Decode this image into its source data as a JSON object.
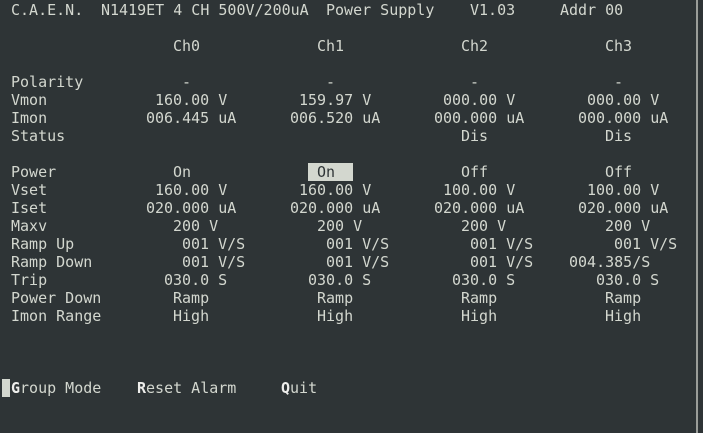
{
  "title": {
    "brand": "C.A.E.N.",
    "model": "N1419ET 4 CH 500V/200uA",
    "product": "Power Supply",
    "version": "V1.03",
    "address": "Addr 00"
  },
  "channels": [
    "Ch0",
    "Ch1",
    "Ch2",
    "Ch3"
  ],
  "rows": [
    {
      "label": "Polarity",
      "values": [
        "-",
        "-",
        "-",
        "-"
      ]
    },
    {
      "label": "Vmon",
      "values": [
        "160.00 V",
        "159.97 V",
        "000.00 V",
        "000.00 V"
      ]
    },
    {
      "label": "Imon",
      "values": [
        "006.445 uA",
        "006.520 uA",
        "000.000 uA",
        "000.000 uA"
      ]
    },
    {
      "label": "Status",
      "values": [
        "",
        "",
        "Dis",
        "Dis"
      ]
    },
    {
      "label": "Power",
      "values": [
        "On",
        "On",
        "Off",
        "Off"
      ]
    },
    {
      "label": "Vset",
      "values": [
        "160.00 V",
        "160.00 V",
        "100.00 V",
        "100.00 V"
      ]
    },
    {
      "label": "Iset",
      "values": [
        "020.000 uA",
        "020.000 uA",
        "020.000 uA",
        "020.000 uA"
      ]
    },
    {
      "label": "Maxv",
      "values": [
        "200 V",
        "200 V",
        "200 V",
        "200 V"
      ]
    },
    {
      "label": "Ramp Up",
      "values": [
        "001 V/S",
        "001 V/S",
        "001 V/S",
        "001 V/S"
      ]
    },
    {
      "label": "Ramp Down",
      "values": [
        "001 V/S",
        "001 V/S",
        "001 V/S",
        "004.385/S"
      ]
    },
    {
      "label": "Trip",
      "values": [
        "030.0 S",
        "030.0 S",
        "030.0 S",
        "030.0 S"
      ]
    },
    {
      "label": "Power Down",
      "values": [
        "Ramp",
        "Ramp",
        "Ramp",
        "Ramp"
      ]
    },
    {
      "label": "Imon Range",
      "values": [
        "High",
        "High",
        "High",
        "High"
      ]
    }
  ],
  "menu": [
    {
      "key": "G",
      "rest": "roup Mode"
    },
    {
      "key": "R",
      "rest": "eset Alarm"
    },
    {
      "key": "Q",
      "rest": "uit"
    }
  ],
  "colors": {
    "background": "#2e3436",
    "text": "#d3d7cf"
  }
}
